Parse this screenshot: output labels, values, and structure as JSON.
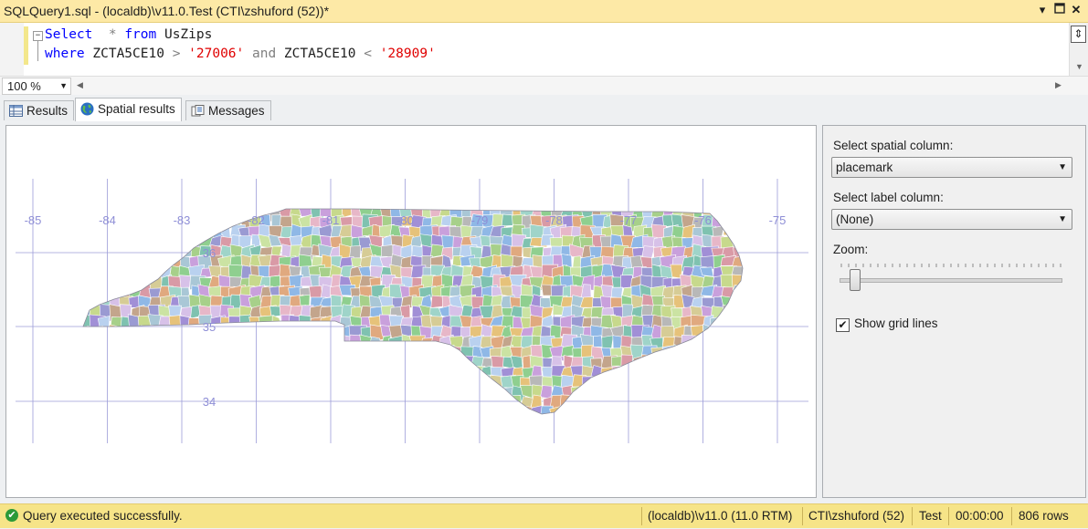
{
  "window": {
    "title": "SQLQuery1.sql - (localdb)\\v11.0.Test (CTI\\zshuford (52))*"
  },
  "editor": {
    "line1": [
      {
        "t": "Select",
        "c": "kw"
      },
      {
        "t": "  * ",
        "c": "op"
      },
      {
        "t": "from",
        "c": "kw"
      },
      {
        "t": " UsZips",
        "c": "id"
      }
    ],
    "line2": [
      {
        "t": "where",
        "c": "kw"
      },
      {
        "t": " ZCTA5CE10 ",
        "c": "id"
      },
      {
        "t": ">",
        "c": "op"
      },
      {
        "t": " ",
        "c": "id"
      },
      {
        "t": "'27006'",
        "c": "str"
      },
      {
        "t": " ",
        "c": "id"
      },
      {
        "t": "and",
        "c": "op"
      },
      {
        "t": " ZCTA5CE10 ",
        "c": "id"
      },
      {
        "t": "<",
        "c": "op"
      },
      {
        "t": " ",
        "c": "id"
      },
      {
        "t": "'28909'",
        "c": "str"
      }
    ],
    "zoom_value": "100 %"
  },
  "tabs": {
    "results": "Results",
    "spatial": "Spatial results",
    "messages": "Messages"
  },
  "map": {
    "longitudes": [
      "-85",
      "-84",
      "-83",
      "-82",
      "-81",
      "-80",
      "-79",
      "-78",
      "-77",
      "-76",
      "-75"
    ],
    "latitudes": [
      "36",
      "35",
      "34"
    ],
    "grid_color": "#9c9cd8"
  },
  "panel": {
    "spatial_label": "Select spatial column:",
    "spatial_value": "placemark",
    "label_label": "Select label column:",
    "label_value": "(None)",
    "zoom_label": "Zoom:",
    "zoom_level": 0.04,
    "gridlines_label": "Show grid lines",
    "gridlines_checked": true
  },
  "status": {
    "message": "Query executed successfully.",
    "server": "(localdb)\\v11.0 (11.0 RTM)",
    "user": "CTI\\zshuford (52)",
    "database": "Test",
    "elapsed": "00:00:00",
    "rows": "806 rows"
  }
}
